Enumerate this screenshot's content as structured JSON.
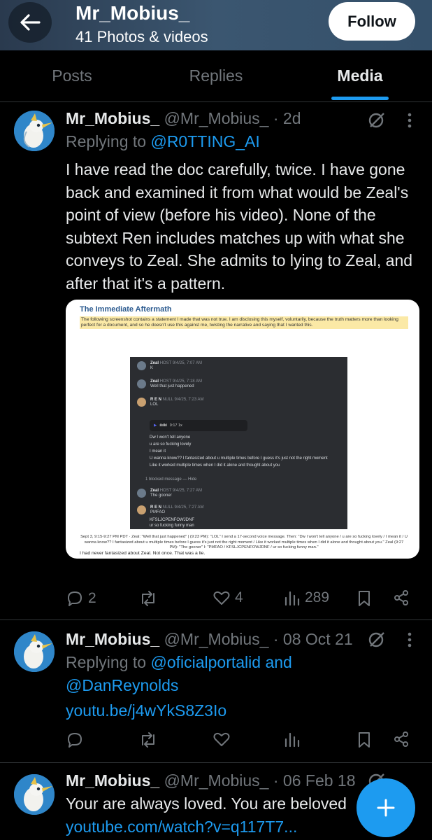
{
  "header": {
    "title": "Mr_Mobius_",
    "subtitle": "41 Photos & videos",
    "follow_label": "Follow"
  },
  "tabs": [
    {
      "label": "Posts",
      "active": false
    },
    {
      "label": "Replies",
      "active": false
    },
    {
      "label": "Media",
      "active": true
    }
  ],
  "posts": [
    {
      "name": "Mr_Mobius_",
      "handle": "@Mr_Mobius_",
      "time": "· 2d",
      "replying_prefix": "Replying to",
      "replying_to": "@R0TTING_AI",
      "text": "I have read the doc carefully, twice. I have gone back and examined it from what would be Zeal's point of view (before his video). None of the subtext Ren includes matches up with what she conveys to Zeal. She admits to lying to Zeal, and after that it's a pattern.",
      "replies": "2",
      "retweets": "",
      "likes": "4",
      "views": "289",
      "image": {
        "title": "The Immediate Aftermath",
        "highlight": "The following screenshot contains a statement I made that was not true. I am disclosing this myself, voluntarily, because the truth matters more than looking perfect for a document, and so he doesn't use this against me, twisting the narrative and saying that I wanted this.",
        "messages": [
          {
            "name": "Zeal",
            "tag": "HOST  9/4/25, 7:07 AM",
            "text": "K"
          },
          {
            "name": "Zeal",
            "tag": "HOST  9/4/25, 7:18 AM",
            "text": "Well that just happened"
          },
          {
            "name": "R E N",
            "tag": "NULL  9/4/25, 7:23 AM",
            "text": "LOL"
          }
        ],
        "voice": "0:17  1x",
        "voice_lines": [
          "Dw I won't tell anyone",
          "u are so fucking lovely",
          "I mean it",
          "U wanna know?? I fantasized about u multiple times before I guess it's just not the right moment",
          "Like it worked multiple times when I did it alone and thought about you"
        ],
        "blocked": "1 blocked message — Hide",
        "messages2": [
          {
            "name": "Zeal",
            "tag": "HOST  9/4/25, 7:27 AM",
            "text": "The gooner"
          },
          {
            "name": "R E N",
            "tag": "NULL  9/4/25, 7:27 AM",
            "text": "PMFAO"
          }
        ],
        "extra_lines": [
          "KFSLJCPENFOWJDNF",
          "ur so fucking funny man"
        ],
        "caption": "Sept 3, 9:15-9:27 PM PDT · Zeal: \"Well that just happened\" | (9:23 PM): \"LOL\" I send a 17-second voice message. Then: \"Dw I won't tell anyone / u are so fucking lovely / I mean it / U wanna know?? I fantasized about u multiple times before I guess it's just not the right moment / Like it worked multiple times when I did it alone and thought about you.\" Zeal (9:27 PM): \"The gooner\" I: \"PMFAO / KFSLJCPENFOWJDNF / ur so fucking funny man.\"",
        "footer": "I had never fantasized about Zeal. Not once. That was a lie."
      }
    },
    {
      "name": "Mr_Mobius_",
      "handle": "@Mr_Mobius_",
      "time": "· 08 Oct 21",
      "replying_prefix": "Replying to",
      "replying_to": "@oficialportalid and",
      "replying_to2": "@DanReynolds",
      "link": "youtu.be/j4wYkS8Z3Io"
    },
    {
      "name": "Mr_Mobius_",
      "handle": "@Mr_Mobius_",
      "time": "· 06 Feb 18",
      "text": "Your are always loved. You are beloved",
      "link": "youtube.com/watch?v=q117T7..."
    }
  ],
  "colors": {
    "accent": "#1d9bf0",
    "muted": "#71767b",
    "background": "#000000",
    "header_bg": "#34506a"
  }
}
